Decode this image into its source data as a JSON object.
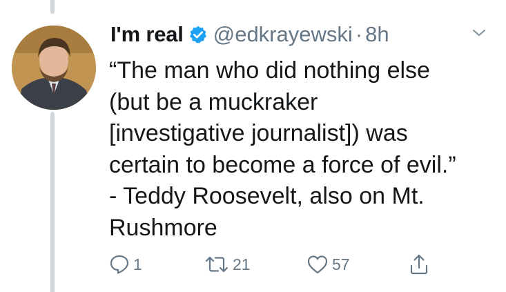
{
  "tweet": {
    "display_name": "I'm real",
    "handle": "@edkrayewski",
    "separator": "·",
    "timestamp": "8h",
    "text": "“The man who did nothing else\n(but be a muckraker\n[investigative journalist]) was\ncertain to become a force of evil.”\n- Teddy Roosevelt, also on Mt.\nRushmore",
    "verified_color": "#1da1f2",
    "actions": {
      "reply_icon": "reply-icon",
      "reply_count": "1",
      "retweet_icon": "retweet-icon",
      "retweet_count": "21",
      "like_icon": "heart-icon",
      "like_count": "57",
      "share_icon": "share-icon"
    }
  },
  "colors": {
    "text": "#14171a",
    "secondary": "#657786",
    "thread_line": "#cfd6dc"
  }
}
